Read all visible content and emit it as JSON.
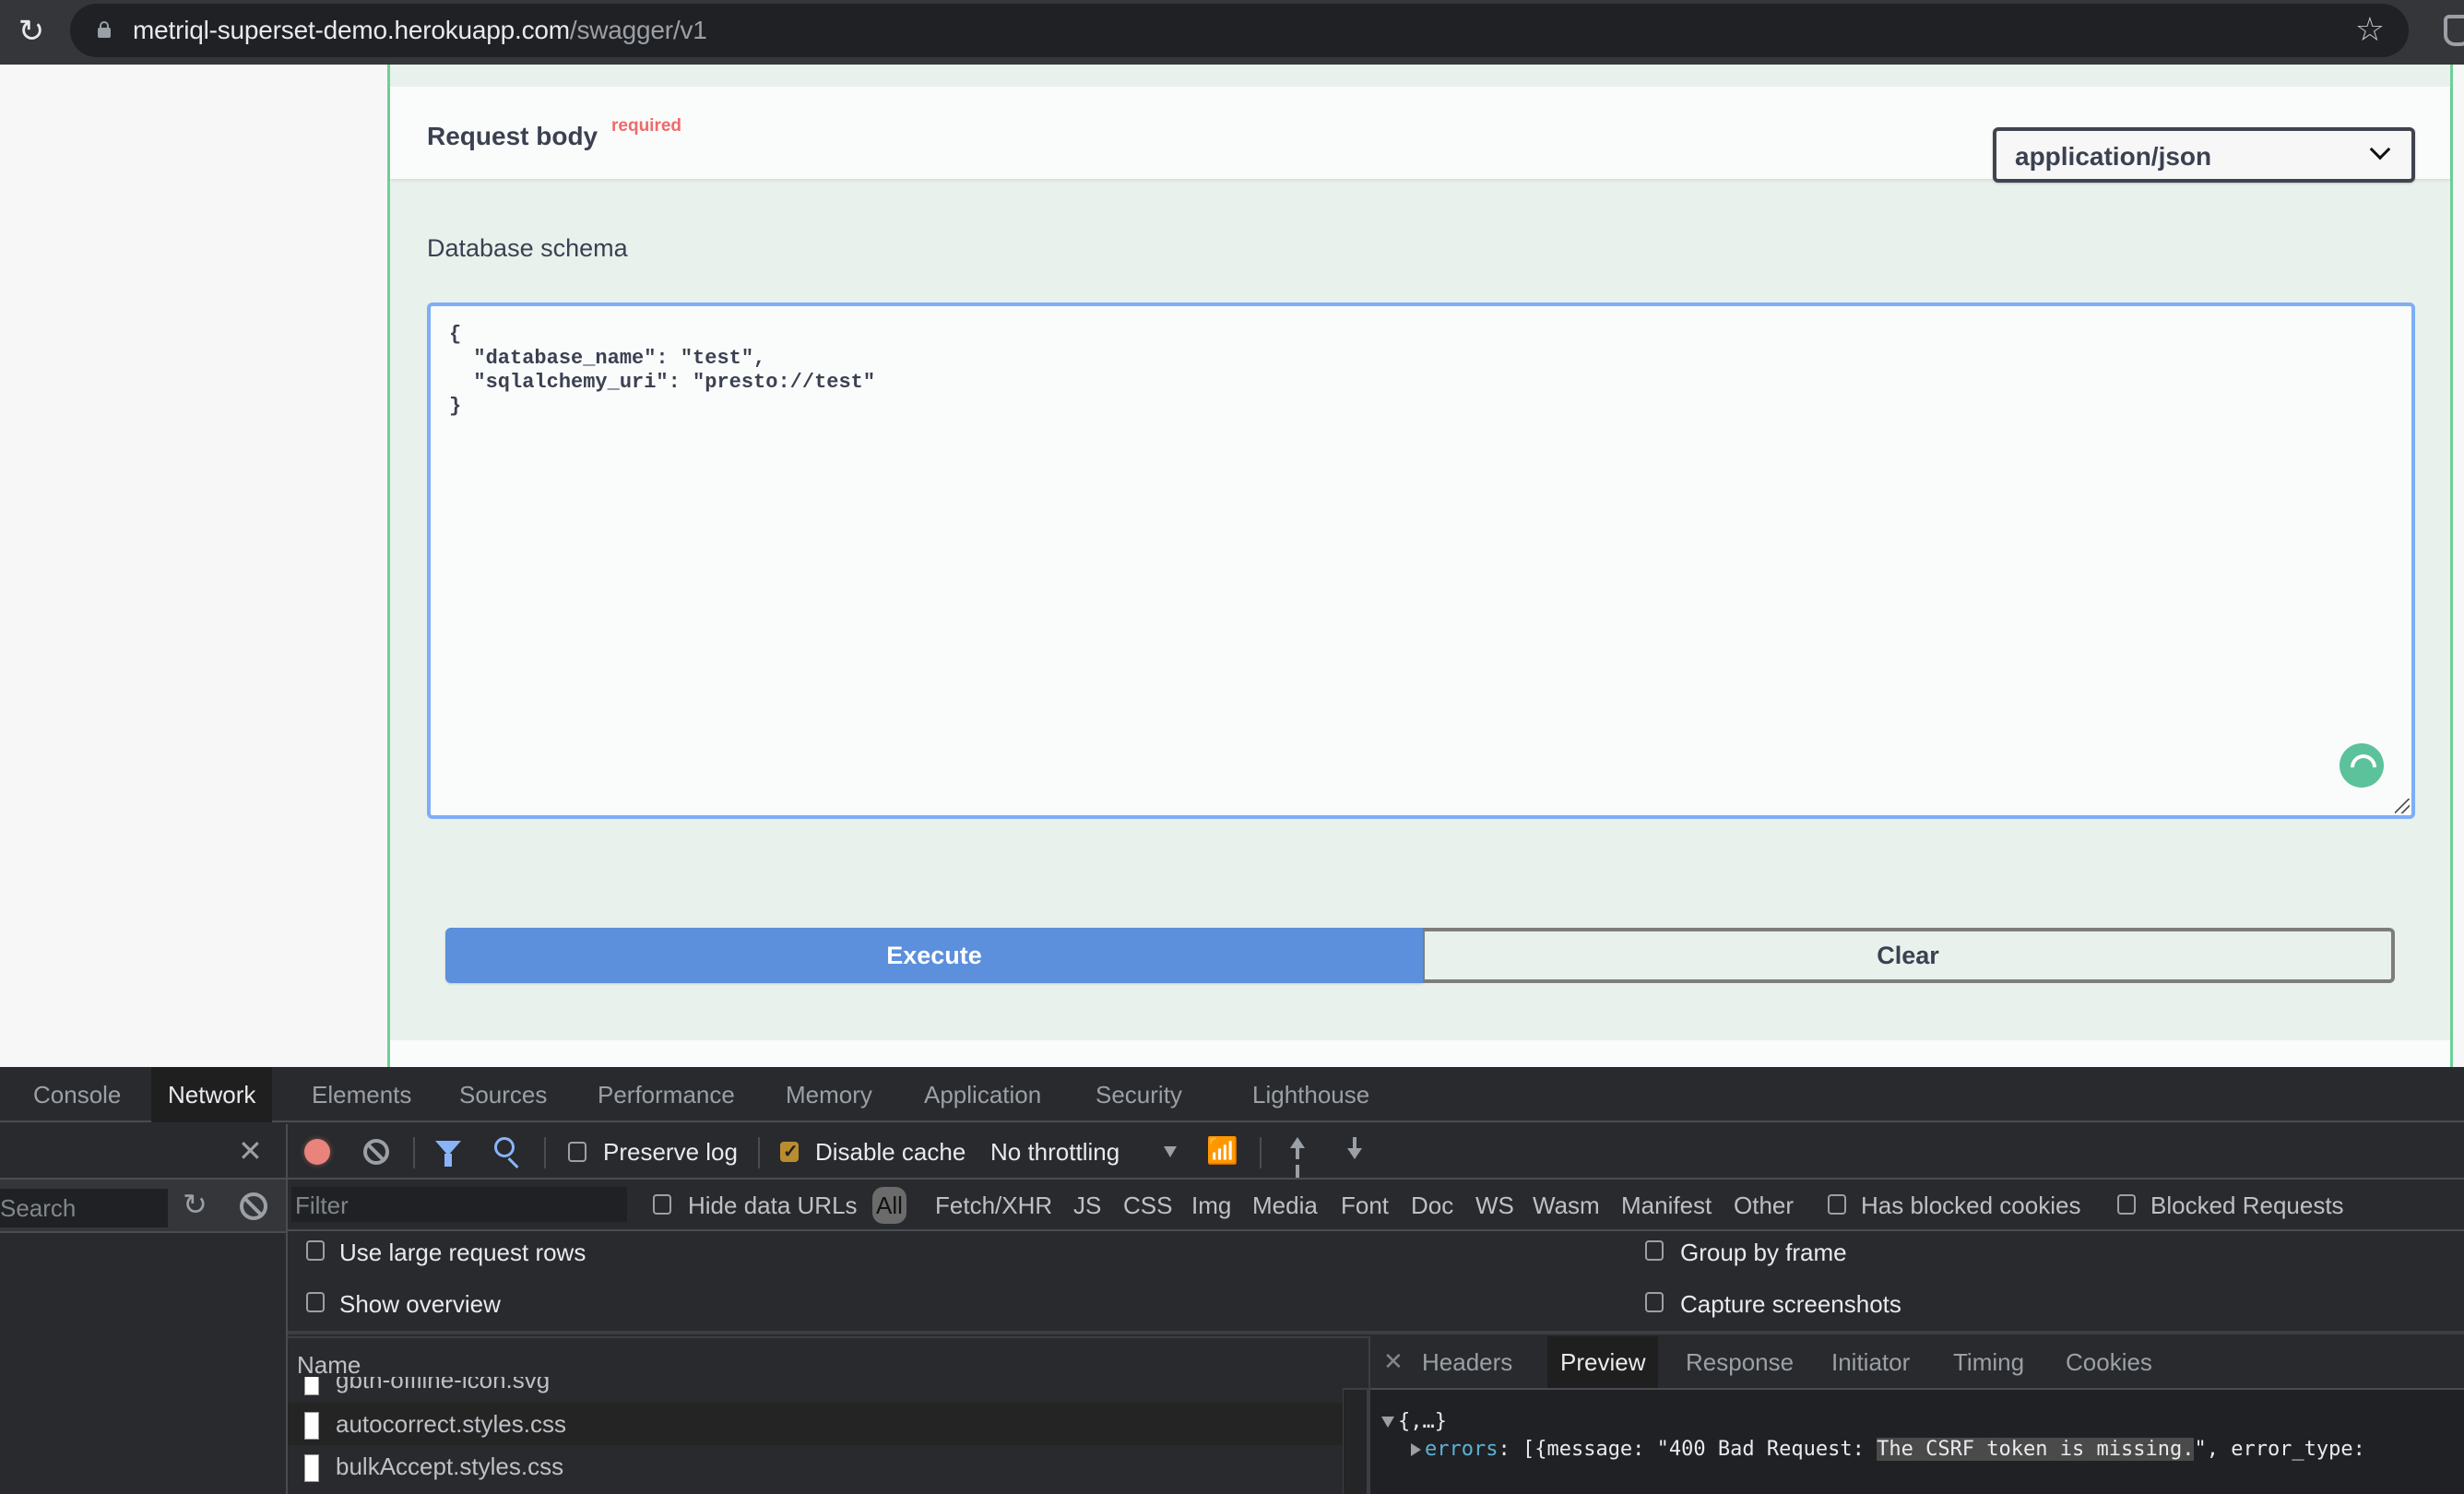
{
  "browser": {
    "url_host": "metriql-superset-demo.herokuapp.com",
    "url_path": "/swagger/v1",
    "reload_icon": "reload-icon",
    "lock_icon": "lock-icon",
    "star_icon": "bookmark-star-icon",
    "extension_icon": "extension-shield-icon"
  },
  "swagger": {
    "request_body": {
      "title": "Request body",
      "required_label": "required",
      "content_type": "application/json",
      "schema_label": "Database schema",
      "body_text": "{\n  \"database_name\": \"test\",\n  \"sqlalchemy_uri\": \"presto://test\"\n}"
    },
    "buttons": {
      "execute": "Execute",
      "clear": "Clear"
    },
    "colors": {
      "execute_bg": "#5c8fdc",
      "section_bg": "#e8f1ec",
      "section_border": "#6fcf97",
      "required": "#f06a6a",
      "editor_focus": "#7eaef5"
    }
  },
  "devtools": {
    "tabs": [
      {
        "label": "Console",
        "active": false
      },
      {
        "label": "Network",
        "active": true
      },
      {
        "label": "Elements",
        "active": false
      },
      {
        "label": "Sources",
        "active": false
      },
      {
        "label": "Performance",
        "active": false
      },
      {
        "label": "Memory",
        "active": false
      },
      {
        "label": "Application",
        "active": false
      },
      {
        "label": "Security",
        "active": false
      },
      {
        "label": "Lighthouse",
        "active": false
      }
    ],
    "search_pane": {
      "placeholder": "Search"
    },
    "toolbar": {
      "preserve_log": {
        "label": "Preserve log",
        "checked": false
      },
      "disable_cache": {
        "label": "Disable cache",
        "checked": true
      },
      "throttling": "No throttling"
    },
    "filter": {
      "placeholder": "Filter",
      "hide_data_urls": {
        "label": "Hide data URLs",
        "checked": false
      },
      "types": [
        "All",
        "Fetch/XHR",
        "JS",
        "CSS",
        "Img",
        "Media",
        "Font",
        "Doc",
        "WS",
        "Wasm",
        "Manifest",
        "Other"
      ],
      "active_type": "All",
      "has_blocked_cookies": {
        "label": "Has blocked cookies",
        "checked": false
      },
      "blocked_requests": {
        "label": "Blocked Requests",
        "checked": false
      }
    },
    "settings": {
      "use_large_rows": {
        "label": "Use large request rows",
        "checked": false
      },
      "show_overview": {
        "label": "Show overview",
        "checked": false
      },
      "group_by_frame": {
        "label": "Group by frame",
        "checked": false
      },
      "capture_screenshots": {
        "label": "Capture screenshots",
        "checked": false
      }
    },
    "requests": {
      "column_header": "Name",
      "rows": [
        {
          "name": "gbth-offline-icon.svg"
        },
        {
          "name": "autocorrect.styles.css"
        },
        {
          "name": "bulkAccept.styles.css"
        }
      ]
    },
    "detail": {
      "tabs": [
        {
          "label": "Headers",
          "active": false
        },
        {
          "label": "Preview",
          "active": true
        },
        {
          "label": "Response",
          "active": false
        },
        {
          "label": "Initiator",
          "active": false
        },
        {
          "label": "Timing",
          "active": false
        },
        {
          "label": "Cookies",
          "active": false
        }
      ],
      "preview": {
        "root": "{,…}",
        "key": "errors",
        "value_prefix": ": [{message: \"400 Bad Request: ",
        "value_highlight": "The CSRF token is missing.",
        "value_suffix": "\", error_type:"
      }
    }
  }
}
